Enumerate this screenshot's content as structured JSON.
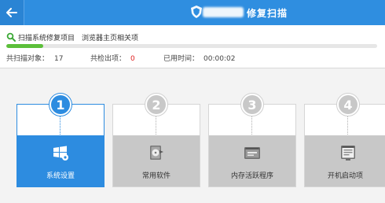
{
  "header": {
    "title_suffix": "修复扫描"
  },
  "scan": {
    "status_text": "扫描系统修复项目",
    "detail_text": "浏览器主页相关项",
    "progress_fraction": 0.1,
    "scanned_label": "共扫描对象：",
    "scanned_count": "17",
    "found_label": "共检出项：",
    "found_count": "0",
    "elapsed_label": "已用时间：",
    "elapsed_time": "00:00:02"
  },
  "steps": [
    {
      "number": "1",
      "label": "系统设置",
      "icon": "windows-settings-icon",
      "active": true
    },
    {
      "number": "2",
      "label": "常用软件",
      "icon": "software-disc-icon",
      "active": false
    },
    {
      "number": "3",
      "label": "内存活跃程序",
      "icon": "memory-program-icon",
      "active": false
    },
    {
      "number": "4",
      "label": "开机启动项",
      "icon": "startup-window-icon",
      "active": false
    }
  ],
  "colors": {
    "titlebar": "#2f8ee0",
    "active_step": "#2d8ce0",
    "inactive_step": "#c8c8c8",
    "progress": "#5cbf3a",
    "found_count": "#e02020"
  }
}
